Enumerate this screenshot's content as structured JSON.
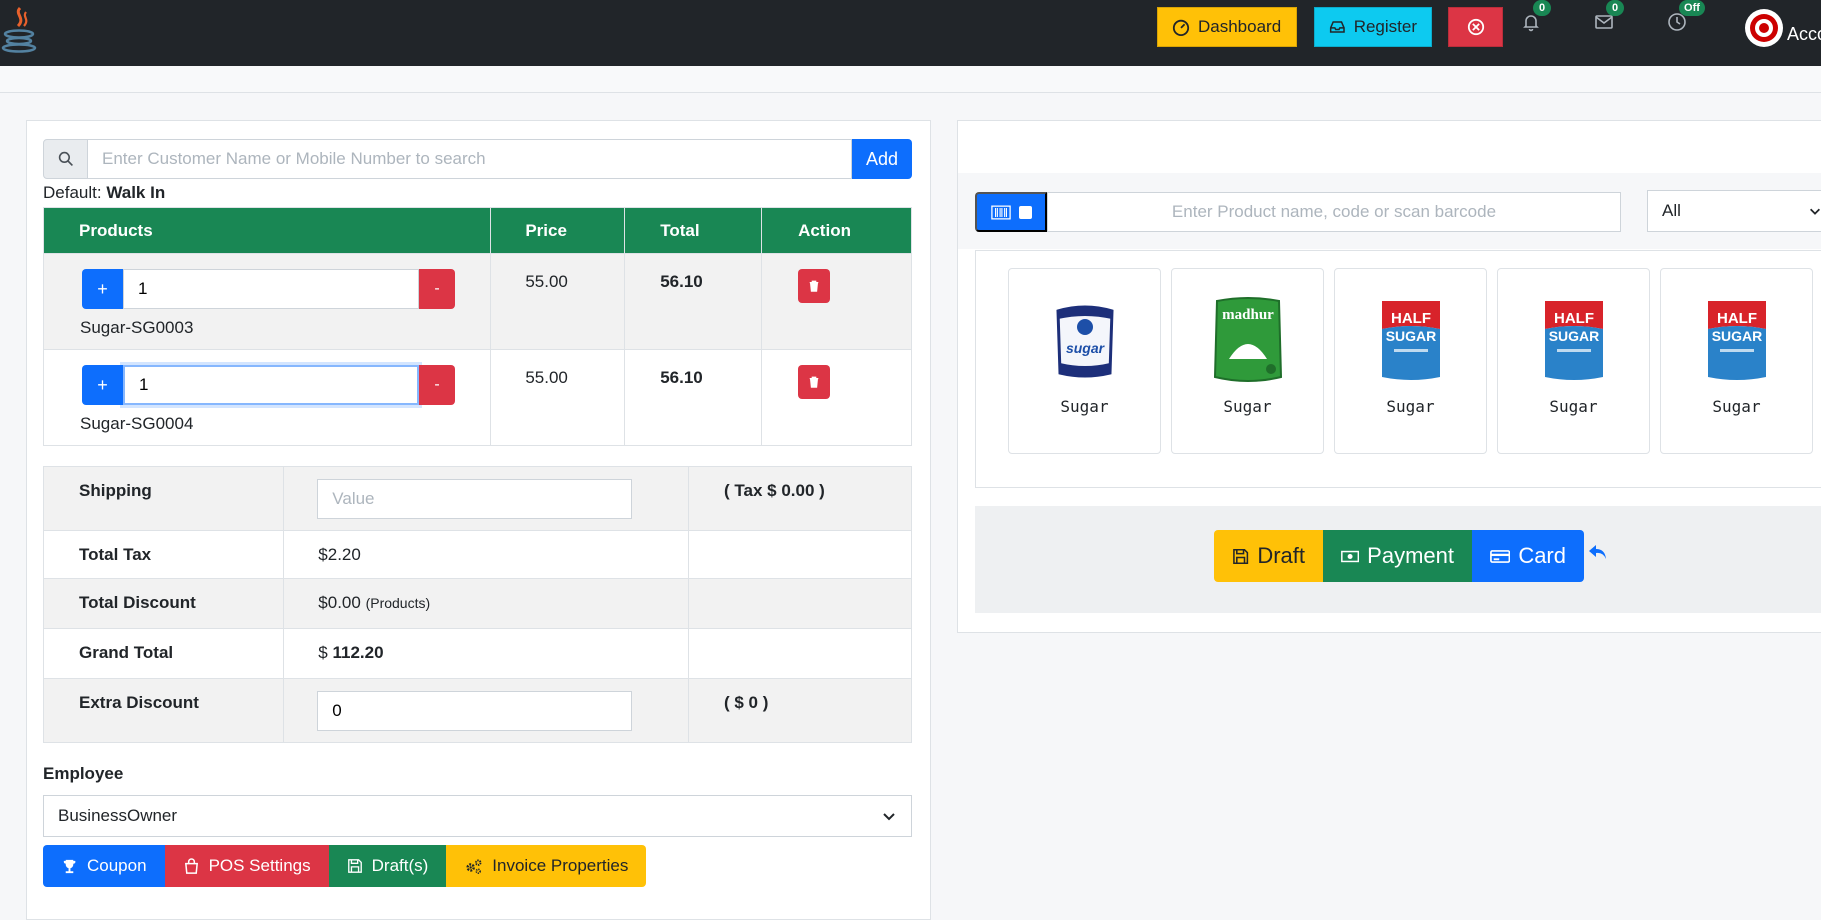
{
  "navbar": {
    "dashboard_label": "Dashboard",
    "register_label": "Register",
    "notifications_count": "0",
    "messages_count": "0",
    "clock_status": "Off",
    "account_label": "Acco"
  },
  "customer": {
    "search_placeholder": "Enter Customer Name or Mobile Number to search",
    "add_label": "Add",
    "default_prefix": "Default:",
    "default_value": "Walk In"
  },
  "products_table": {
    "headers": [
      "Products",
      "Price",
      "Total",
      "Action"
    ],
    "rows": [
      {
        "qty": "1",
        "plus": "+",
        "minus": "-",
        "name": "Sugar-SG0003",
        "price": "55.00",
        "total": "56.10"
      },
      {
        "qty": "1",
        "plus": "+",
        "minus": "-",
        "name": "Sugar-SG0004",
        "price": "55.00",
        "total": "56.10"
      }
    ]
  },
  "totals": {
    "shipping_label": "Shipping",
    "shipping_placeholder": "Value",
    "shipping_tax": "( Tax $ 0.00 )",
    "tax_label": "Total Tax",
    "tax_value": "$2.20",
    "discount_label": "Total Discount",
    "discount_value": "$0.00",
    "discount_note": "(Products)",
    "grand_label": "Grand Total",
    "grand_prefix": "$",
    "grand_value": "112.20",
    "extra_label": "Extra Discount",
    "extra_value": "0",
    "extra_note": "( $ 0 )"
  },
  "employee": {
    "label": "Employee",
    "selected": "BusinessOwner"
  },
  "bottom_buttons": {
    "coupon": "Coupon",
    "pos_settings": "POS Settings",
    "drafts": "Draft(s)",
    "invoice_properties": "Invoice Properties"
  },
  "product_search": {
    "placeholder": "Enter Product name, code or scan barcode",
    "category": "All"
  },
  "products_grid": [
    {
      "name": "Sugar",
      "icon": "sugar-pack-white"
    },
    {
      "name": "Sugar",
      "icon": "sugar-pack-green"
    },
    {
      "name": "Sugar",
      "icon": "sugar-pack-red"
    },
    {
      "name": "Sugar",
      "icon": "sugar-pack-red"
    },
    {
      "name": "Sugar",
      "icon": "sugar-pack-red"
    }
  ],
  "actions": {
    "draft": "Draft",
    "payment": "Payment",
    "card": "Card"
  },
  "colors": {
    "navbar": "#212529",
    "primary": "#0d6efd",
    "success": "#198754",
    "danger": "#dc3545",
    "warning": "#ffc107",
    "info": "#0dcaf0"
  }
}
